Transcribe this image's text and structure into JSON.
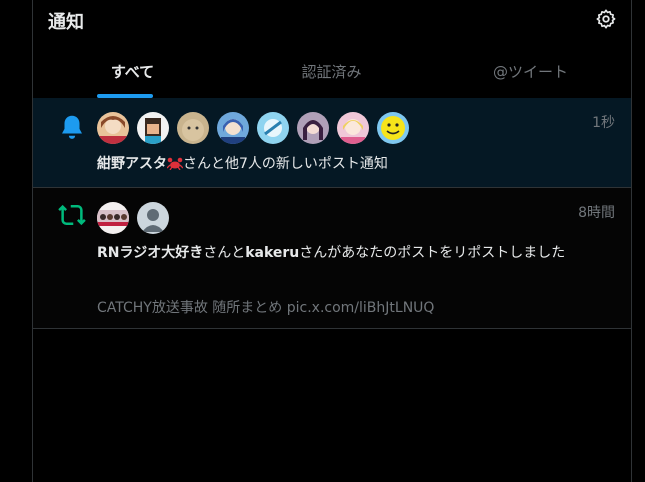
{
  "header": {
    "title": "通知",
    "settings_icon": "gear-icon"
  },
  "tabs": [
    {
      "label": "すべて",
      "active": true
    },
    {
      "label": "認証済み",
      "active": false
    },
    {
      "label": "@ツイート",
      "active": false
    }
  ],
  "notifications": [
    {
      "type_icon": "bell-icon",
      "time": "1秒",
      "actor": "紺野アスタ",
      "actor_emoji": "crab-icon",
      "text": "さんと他7人の新しいポスト通知",
      "avatar_count": 8
    },
    {
      "type_icon": "repost-icon",
      "time": "8時間",
      "actor1": "RNラジオ大好き",
      "mid": "さんと",
      "actor2": "kakeru",
      "text": "さんがあなたのポストをリポストしました",
      "preview": "CATCHY放送事故 随所まとめ pic.x.com/liBhJtLNUQ",
      "avatar_count": 2
    }
  ],
  "colors": {
    "accent": "#1d9bf0",
    "repost": "#00ba7c",
    "background": "#000000",
    "highlight_bg": "#051824"
  }
}
